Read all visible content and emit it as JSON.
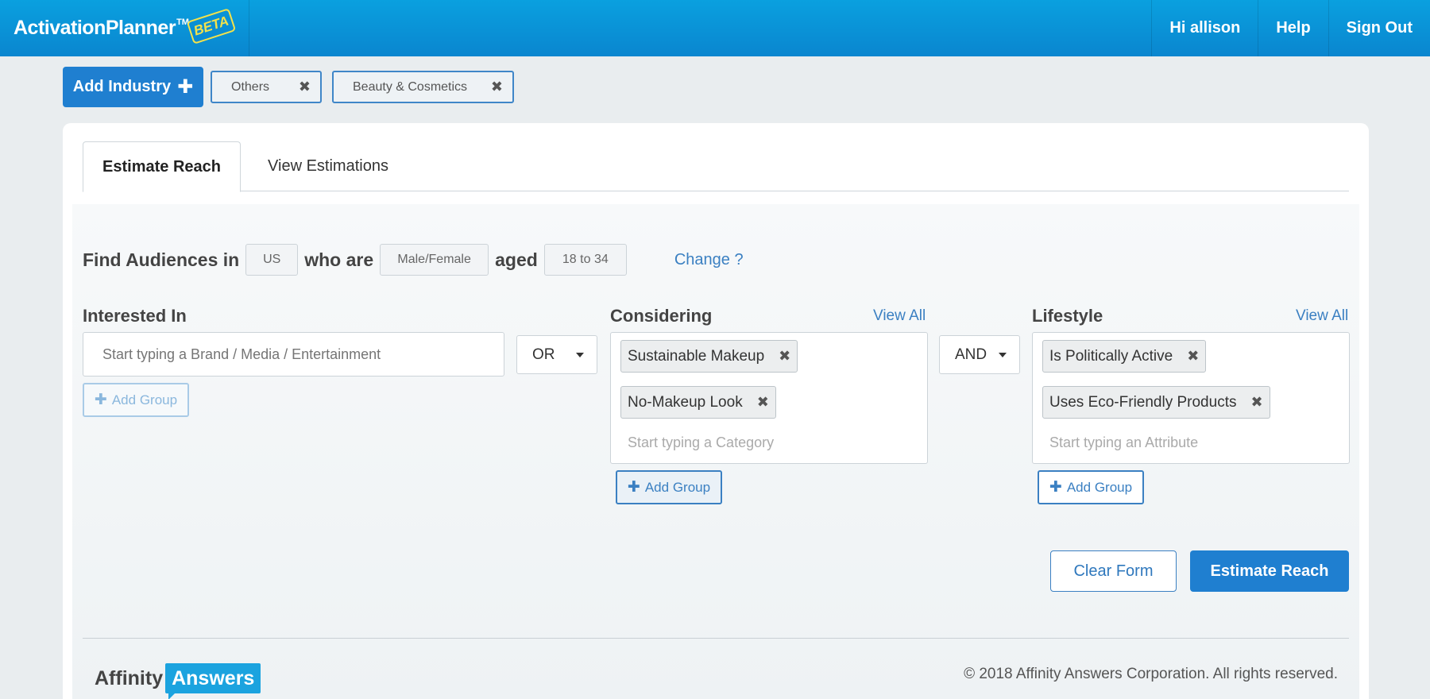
{
  "header": {
    "brand": "ActivationPlanner",
    "trademark": "TM",
    "beta": "BETA",
    "nav": [
      "Hi allison",
      "Help",
      "Sign Out"
    ]
  },
  "industries": {
    "add_label": "Add Industry",
    "tags": [
      "Others",
      "Beauty & Cosmetics"
    ]
  },
  "tabs": [
    "Estimate Reach",
    "View Estimations"
  ],
  "find": {
    "prefix": "Find Audiences in",
    "country": "US",
    "who_are": "who are",
    "gender": "Male/Female",
    "aged": "aged",
    "age_range": "18 to 34",
    "change": "Change ?"
  },
  "interested": {
    "label": "Interested In",
    "placeholder": "Start typing a Brand / Media / Entertainment",
    "add_group": "Add Group"
  },
  "operator1": "OR",
  "considering": {
    "label": "Considering",
    "view_all": "View All",
    "chips": [
      "Sustainable Makeup",
      "No-Makeup Look"
    ],
    "placeholder": "Start typing a Category",
    "add_group": "Add Group"
  },
  "operator2": "AND",
  "lifestyle": {
    "label": "Lifestyle",
    "view_all": "View All",
    "chips": [
      "Is Politically Active",
      "Uses Eco-Friendly Products"
    ],
    "placeholder": "Start typing an Attribute",
    "add_group": "Add Group"
  },
  "actions": {
    "clear": "Clear Form",
    "estimate": "Estimate Reach"
  },
  "footer": {
    "logo_part1": "Affinity",
    "logo_part2": "Answers",
    "copyright": "© 2018 Affinity Answers Corporation. All rights reserved."
  },
  "colors": {
    "header": "#0a8fd4",
    "primary": "#1f7fd0",
    "link": "#3b80c2"
  }
}
